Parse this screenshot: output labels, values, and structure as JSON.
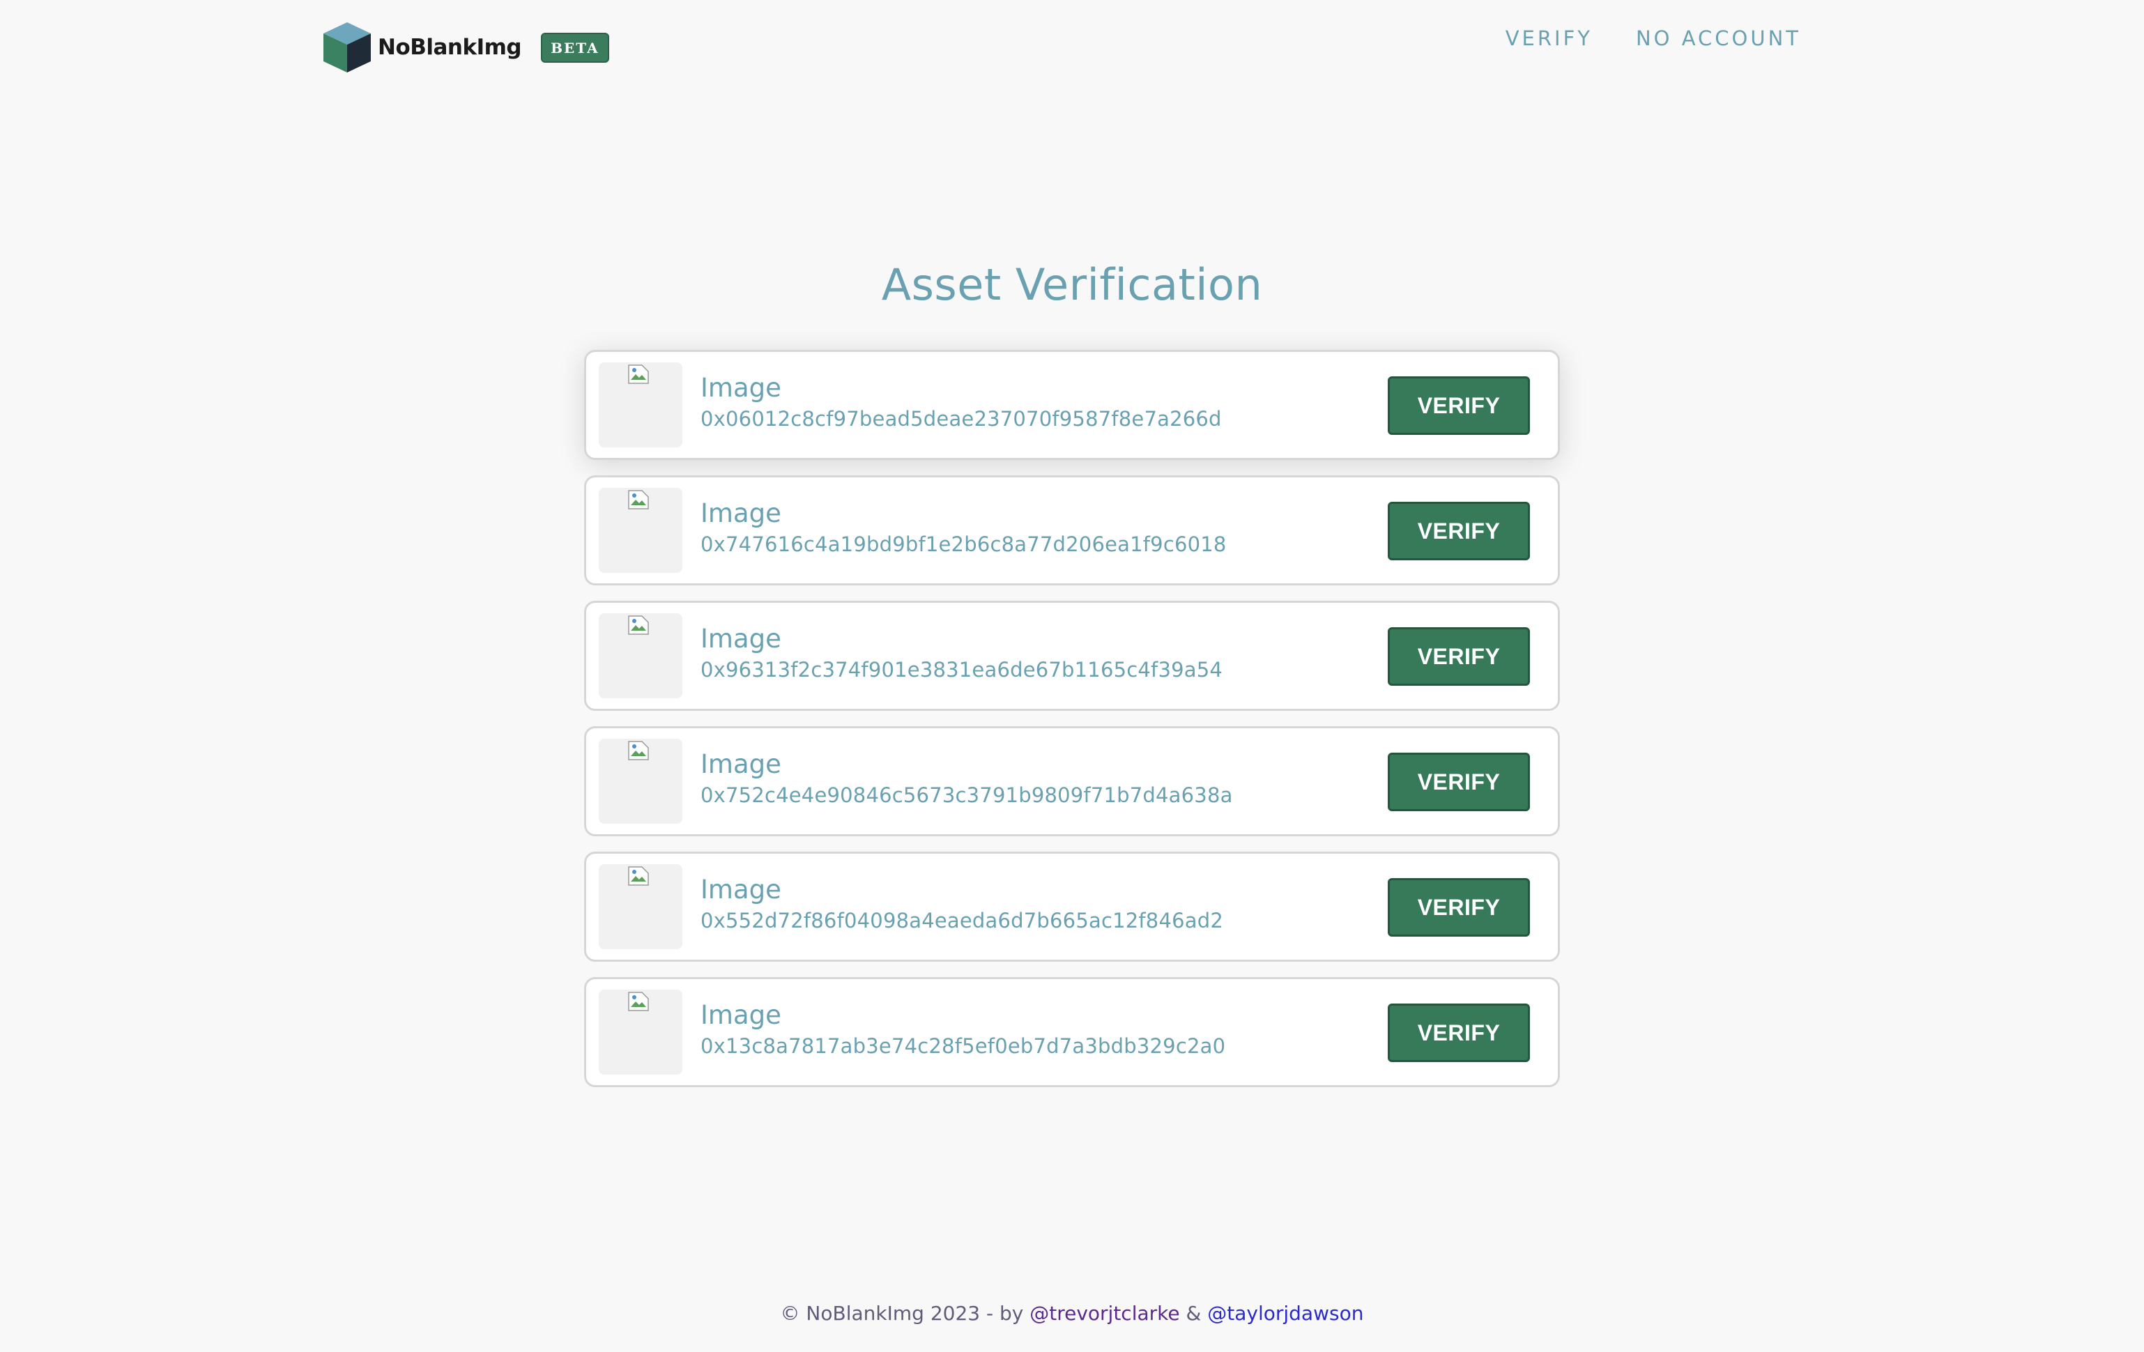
{
  "header": {
    "logo_text": "NoBlankImg",
    "badge": "BETA",
    "nav": [
      {
        "label": "VERIFY"
      },
      {
        "label": "NO ACCOUNT"
      }
    ]
  },
  "main": {
    "title": "Asset Verification",
    "assets": [
      {
        "title": "Image",
        "hash": "0x06012c8cf97bead5deae237070f9587f8e7a266d",
        "button": "VERIFY"
      },
      {
        "title": "Image",
        "hash": "0x747616c4a19bd9bf1e2b6c8a77d206ea1f9c6018",
        "button": "VERIFY"
      },
      {
        "title": "Image",
        "hash": "0x96313f2c374f901e3831ea6de67b1165c4f39a54",
        "button": "VERIFY"
      },
      {
        "title": "Image",
        "hash": "0x752c4e4e90846c5673c3791b9809f71b7d4a638a",
        "button": "VERIFY"
      },
      {
        "title": "Image",
        "hash": "0x552d72f86f04098a4eaeda6d7b665ac12f846ad2",
        "button": "VERIFY"
      },
      {
        "title": "Image",
        "hash": "0x13c8a7817ab3e74c28f5ef0eb7d7a3bdb329c2a0",
        "button": "VERIFY"
      }
    ]
  },
  "footer": {
    "prefix": "© NoBlankImg 2023 - by ",
    "author1": "@trevorjtclarke",
    "separator": " & ",
    "author2": "@taylorjdawson"
  },
  "colors": {
    "accent": "#6aa1b0",
    "button": "#367a5a",
    "background": "#f8f8f8"
  }
}
